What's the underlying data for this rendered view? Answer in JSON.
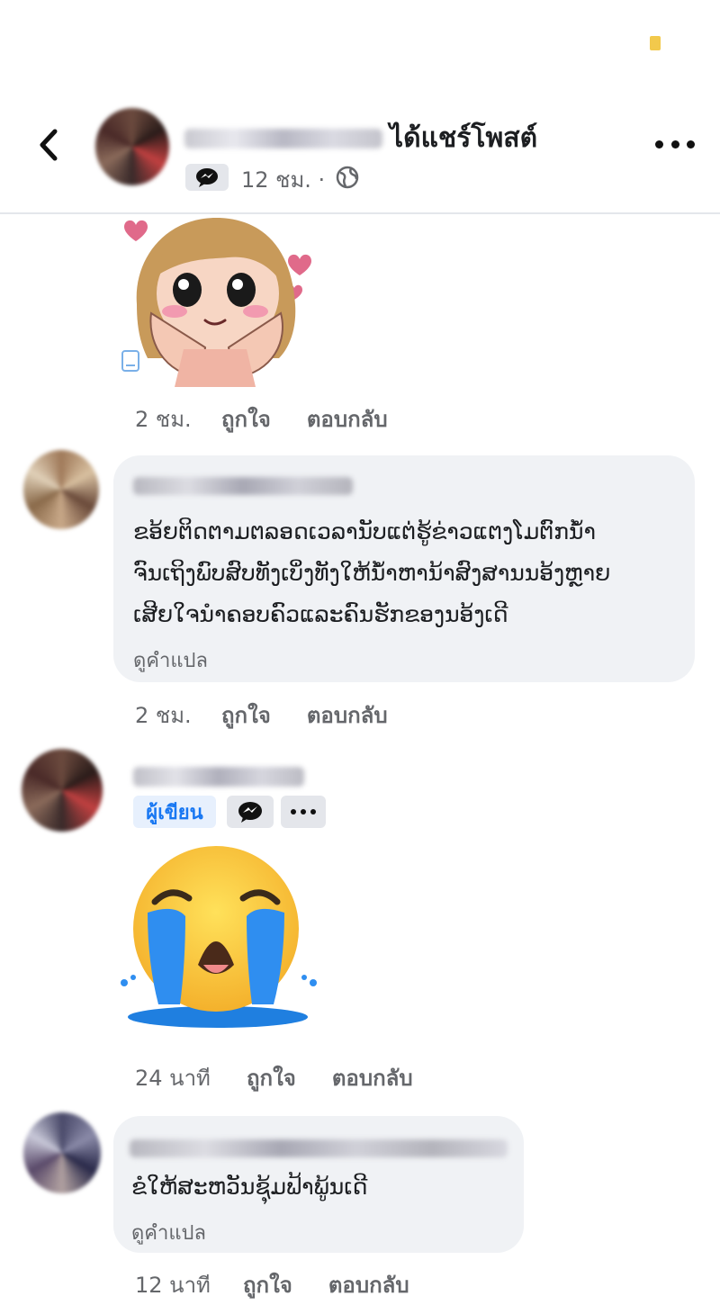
{
  "header": {
    "title": "ได้แชร์โพสต์",
    "meta_time": "12 ชม. ·",
    "back_icon": "chevron-left-icon",
    "more_icon": "more-horizontal-icon",
    "privacy_icon": "globe-icon",
    "messenger_icon": "messenger-icon"
  },
  "comments": [
    {
      "type": "sticker",
      "sticker_icon": "girl-hearts-sticker-icon",
      "time": "2 ชม.",
      "like": "ถูกใจ",
      "reply": "ตอบกลับ"
    },
    {
      "type": "text",
      "text_lines": [
        "ຂອ້ຍຕິດຕາມຕລອດເວລານັບແຕ່ຮູ້ຂ່າວແຕງໂມຕົກນ້ຳ",
        "ຈົນເຖິງພົບສົບທັງເບິ່ງທັງໃຫ້ນ້ຳຫານ້າສົງສານນອ້ງຫຼາຍ",
        "ເສີຍໃຈນຳຄອບຄົວແລະຄົນຮັກຂອງນອ້ງເດີ"
      ],
      "translate": "ดูคำแปล",
      "time": "2 ชม.",
      "like": "ถูกใจ",
      "reply": "ตอบกลับ"
    },
    {
      "type": "emoji",
      "author_badge": "ผู้เขียน",
      "emoji_icon": "loudly-crying-face-icon",
      "time": "24 นาที",
      "like": "ถูกใจ",
      "reply": "ตอบกลับ"
    },
    {
      "type": "text",
      "text_lines": [
        "ຂໍໃຫ້ສະຫວັນຊຸ້ມຟ້າພູ້ນເດີ"
      ],
      "translate": "ดูคำแปล",
      "time": "12 นาที",
      "like": "ถูกใจ",
      "reply": "ตอบกลับ"
    }
  ],
  "colors": {
    "bubble": "#f0f2f5",
    "meta_text": "#65676b",
    "author_badge_bg": "#e7f0fd",
    "author_badge_text": "#1877f2"
  }
}
